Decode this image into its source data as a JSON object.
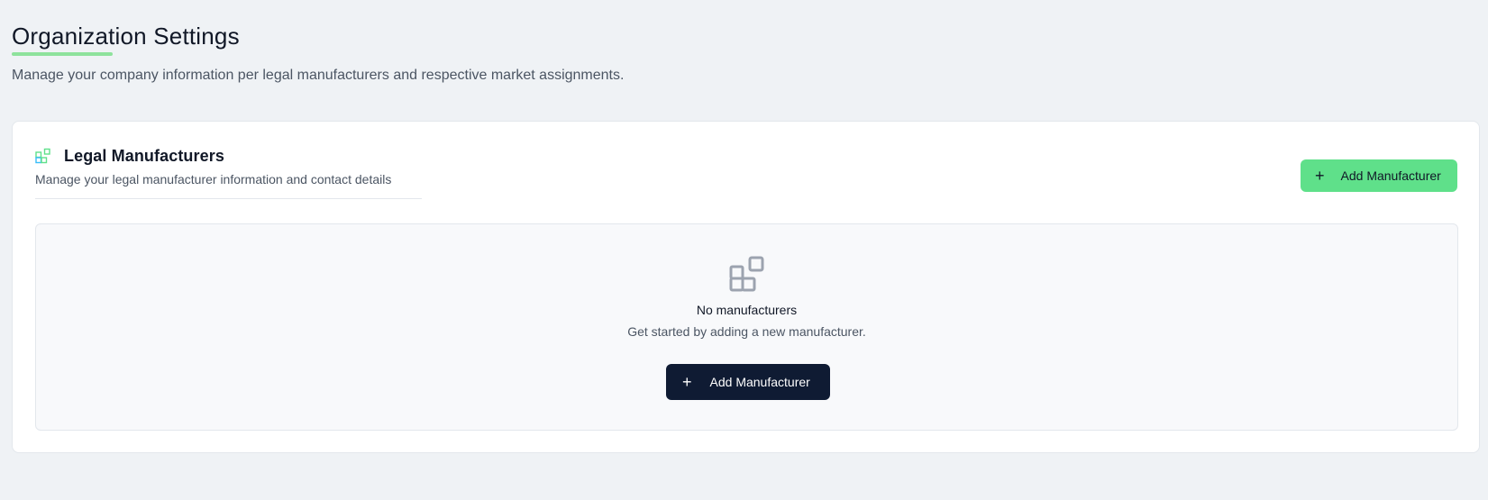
{
  "header": {
    "title": "Organization Settings",
    "subtitle": "Manage your company information per legal manufacturers and respective market assignments."
  },
  "card": {
    "icon": "squares-plus-icon",
    "title": "Legal Manufacturers",
    "description": "Manage your legal manufacturer information and contact details",
    "add_button_label": "Add Manufacturer",
    "add_button_icon": "plus-icon"
  },
  "empty_state": {
    "icon": "squares-plus-icon",
    "title": "No manufacturers",
    "description": "Get started by adding a new manufacturer.",
    "button_label": "Add Manufacturer",
    "button_icon": "plus-icon"
  },
  "colors": {
    "accent_green": "#5fe08a",
    "underline_green": "#8ee29c",
    "dark_navy": "#0f1b33",
    "background": "#eff2f5"
  }
}
